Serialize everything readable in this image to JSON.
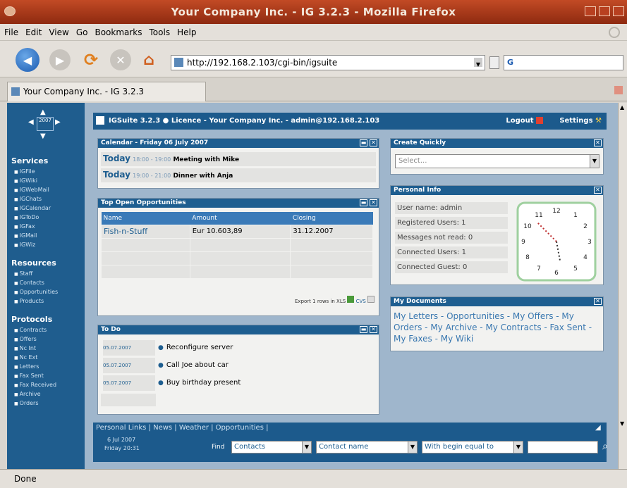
{
  "window": {
    "title": "Your Company Inc. - IG 3.2.3 - Mozilla Firefox"
  },
  "menu": [
    "File",
    "Edit",
    "View",
    "Go",
    "Bookmarks",
    "Tools",
    "Help"
  ],
  "toolbar": {
    "url": "http://192.168.2.103/cgi-bin/igsuite"
  },
  "tab": {
    "label": "Your Company Inc. - IG 3.2.3"
  },
  "sidebar": {
    "year_box": "2007",
    "sections": [
      {
        "title": "Services",
        "items": [
          "IGFile",
          "IGWiki",
          "IGWebMail",
          "IGChats",
          "IGCalendar",
          "IGToDo",
          "IGFax",
          "IGMail",
          "IGWiz"
        ]
      },
      {
        "title": "Resources",
        "items": [
          "Staff",
          "Contacts",
          "Opportunities",
          "Products"
        ]
      },
      {
        "title": "Protocols",
        "items": [
          "Contracts",
          "Offers",
          "Nc Int",
          "Nc Ext",
          "Letters",
          "Fax Sent",
          "Fax Received",
          "Archive",
          "Orders"
        ]
      }
    ]
  },
  "appbar": {
    "text": "IGSuite 3.2.3 ● Licence - Your Company Inc. - admin@192.168.2.103",
    "logout": "Logout",
    "settings": "Settings"
  },
  "calendar": {
    "title": "Calendar - Friday 06 July 2007",
    "events": [
      {
        "day": "Today",
        "time": "18:00 - 19:00",
        "text": "Meeting with Mike"
      },
      {
        "day": "Today",
        "time": "19:00 - 21:00",
        "text": "Dinner with Anja"
      }
    ]
  },
  "opportunities": {
    "title": "Top Open Opportunities",
    "columns": [
      "Name",
      "Amount",
      "Closing"
    ],
    "rows": [
      [
        "Fish-n-Stuff",
        "Eur 10.603,89",
        "31.12.2007"
      ]
    ],
    "export": "Export 1 rows in XLS",
    "csv": "CVS"
  },
  "todo": {
    "title": "To Do",
    "items": [
      {
        "date": "05.07.2007",
        "text": "Reconfigure server"
      },
      {
        "date": "05.07.2007",
        "text": "Call Joe about car"
      },
      {
        "date": "05.07.2007",
        "text": "Buy birthday present"
      }
    ]
  },
  "create_quickly": {
    "title": "Create Quickly",
    "select": "Select..."
  },
  "personal_info": {
    "title": "Personal Info",
    "rows": [
      "User name: admin",
      "Registered Users: 1",
      "Messages not read: 0",
      "Connected Users: 1",
      "Connected Guest: 0"
    ]
  },
  "documents": {
    "title": "My Documents",
    "text": "My Letters - Opportunities - My Offers - My Orders - My Archive - My Contracts - Fax Sent - My Faxes - My Wiki"
  },
  "bottom": {
    "links": "Personal Links | News | Weather | Opportunities |",
    "date": "6 Jul 2007",
    "day": "Friday 20:31",
    "find_label": "Find",
    "find_in": "Contacts",
    "find_field": "Contact name",
    "find_mode": "With begin equal to"
  },
  "status": {
    "text": "Done"
  },
  "colors": {
    "accent": "#1e5e90",
    "titlebar": "#a83a1a"
  }
}
